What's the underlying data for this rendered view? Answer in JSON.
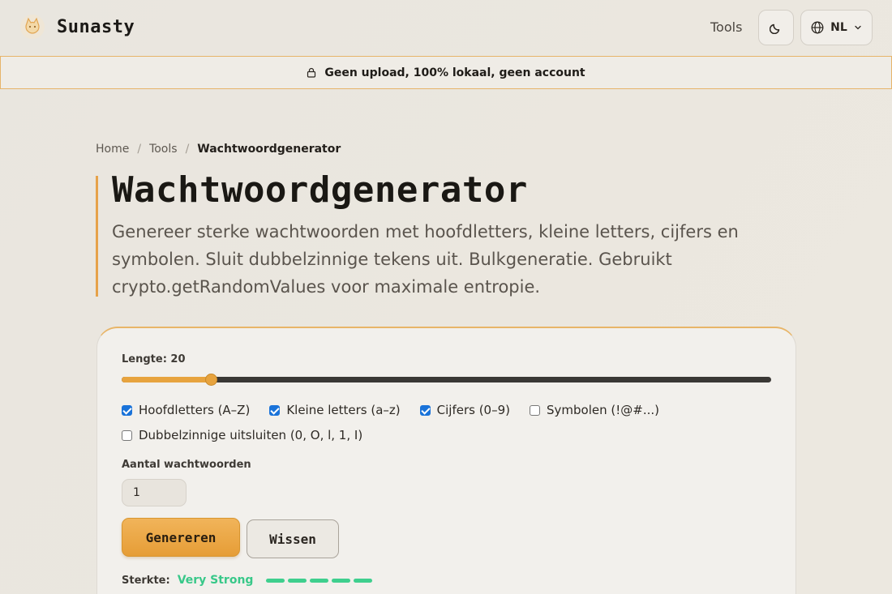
{
  "header": {
    "brand": "Sunasty",
    "nav_tools": "Tools",
    "language": "NL"
  },
  "banner": {
    "text": "Geen upload, 100% lokaal, geen account"
  },
  "breadcrumb": {
    "home": "Home",
    "tools": "Tools",
    "current": "Wachtwoordgenerator",
    "separator": "/"
  },
  "hero": {
    "title": "Wachtwoordgenerator",
    "description": "Genereer sterke wachtwoorden met hoofdletters, kleine letters, cijfers en symbolen. Sluit dubbelzinnige tekens uit. Bulkgeneratie. Gebruikt crypto.getRandomValues voor maximale entropie."
  },
  "generator": {
    "length_label": "Lengte: 20",
    "length_value": 20,
    "length_fill_fraction": 0.137,
    "options": [
      {
        "label": "Hoofdletters (A–Z)",
        "checked": true
      },
      {
        "label": "Kleine letters (a–z)",
        "checked": true
      },
      {
        "label": "Cijfers (0–9)",
        "checked": true
      },
      {
        "label": "Symbolen (!@#...)",
        "checked": false
      },
      {
        "label": "Dubbelzinnige uitsluiten (0, O, l, 1, I)",
        "checked": false
      }
    ],
    "count_label": "Aantal wachtwoorden",
    "count_value": "1",
    "generate_label": "Genereren",
    "clear_label": "Wissen",
    "strength_label": "Sterkte:",
    "strength_value": "Very Strong",
    "strength_level": 5,
    "strength_max": 5
  },
  "colors": {
    "accent": "#e7a33e",
    "strength": "#3fcf8e",
    "checkbox": "#1a73d9"
  },
  "icons": {
    "logo": "cat-logo",
    "theme": "moon-icon",
    "language": "globe-icon",
    "dropdown": "chevron-down-icon",
    "banner": "lock-icon"
  }
}
